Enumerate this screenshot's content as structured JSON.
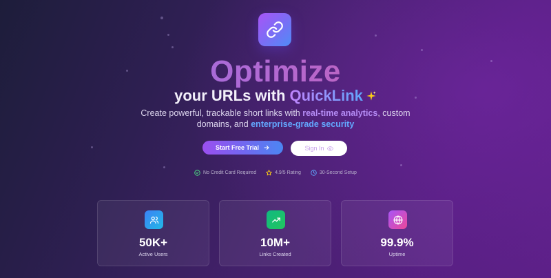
{
  "hero": {
    "title_big": "Optimize",
    "title_prefix": "your URLs with ",
    "title_brand": "QuickLink",
    "logo_icon": "link-icon",
    "sparkle_icon": "sparkle-icon"
  },
  "description": {
    "part1": "Create powerful, trackable short links with ",
    "highlight1": "real-time analytics",
    "part2": ", custom domains, and ",
    "highlight2": "enterprise-grade security"
  },
  "buttons": {
    "primary_label": "Start Free Trial",
    "primary_icon": "arrow-right-icon",
    "secondary_label": "Sign In",
    "secondary_icon": "eye-icon"
  },
  "badges": [
    {
      "label": "No Credit Card Required",
      "icon": "check-circle-icon",
      "color": "#4ade80"
    },
    {
      "label": "4.9/5 Rating",
      "icon": "star-icon",
      "color": "#facc15"
    },
    {
      "label": "30-Second Setup",
      "icon": "clock-icon",
      "color": "#60a5fa"
    }
  ],
  "stats": [
    {
      "value": "50K+",
      "label": "Active Users",
      "icon": "users-icon",
      "color": "#3b82f6"
    },
    {
      "value": "10M+",
      "label": "Links Created",
      "icon": "trending-up-icon",
      "color": "#10b981"
    },
    {
      "value": "99.9%",
      "label": "Uptime",
      "icon": "globe-icon",
      "color": "#c026d3"
    }
  ],
  "colors": {
    "accent_purple": "#a855f7",
    "accent_blue": "#3b82f6",
    "background": "#45216d"
  }
}
